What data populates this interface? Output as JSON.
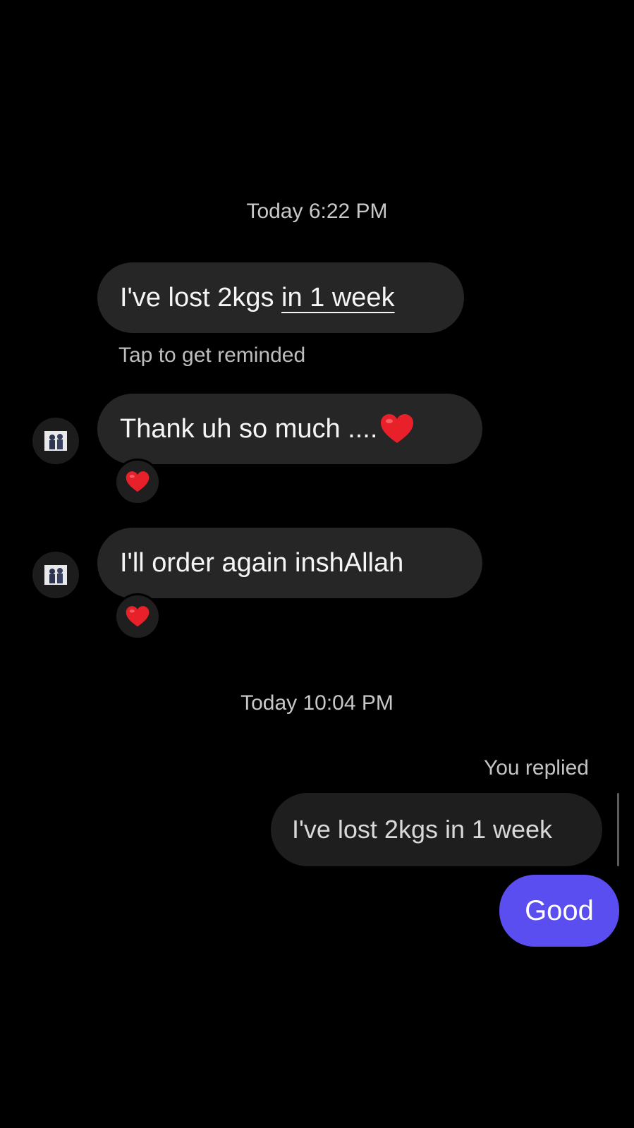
{
  "conversation": {
    "timestamp_1": "Today 6:22 PM",
    "message_1": {
      "text_plain": "I've lost 2kgs ",
      "text_underlined": "in 1 week",
      "hint": "Tap to get reminded"
    },
    "message_2": {
      "text": "Thank uh so much ....",
      "emoji": "red-heart-icon",
      "reaction": "red-heart-icon"
    },
    "message_3": {
      "text": "I'll order again inshAllah",
      "reaction": "red-heart-icon"
    },
    "timestamp_2": "Today 10:04 PM",
    "reply": {
      "label": "You replied",
      "quoted_text": "I've lost 2kgs in 1 week",
      "sent_text": "Good"
    }
  },
  "colors": {
    "background": "#000000",
    "received_bubble": "#262626",
    "sent_bubble": "#5b4ef0",
    "heart": "#e8202a"
  }
}
